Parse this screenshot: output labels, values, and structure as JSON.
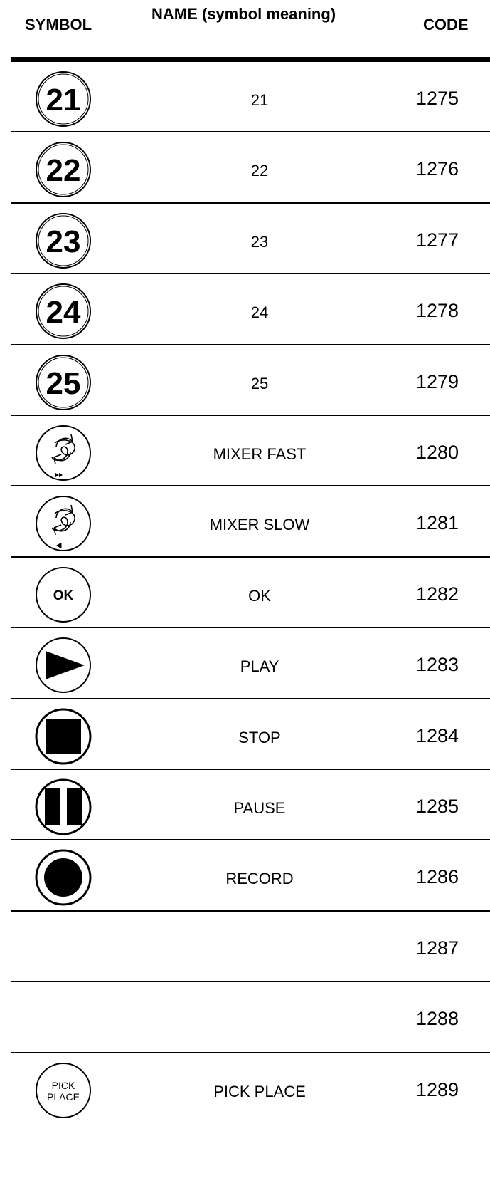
{
  "header": {
    "symbol": "SYMBOL",
    "name": "NAME (symbol meaning)",
    "code": "CODE"
  },
  "rows": [
    {
      "icon": "number-21-icon",
      "glyph": "21",
      "name": "21",
      "code": "1275"
    },
    {
      "icon": "number-22-icon",
      "glyph": "22",
      "name": "22",
      "code": "1276"
    },
    {
      "icon": "number-23-icon",
      "glyph": "23",
      "name": "23",
      "code": "1277"
    },
    {
      "icon": "number-24-icon",
      "glyph": "24",
      "name": "24",
      "code": "1278"
    },
    {
      "icon": "number-25-icon",
      "glyph": "25",
      "name": "25",
      "code": "1279"
    },
    {
      "icon": "mixer-fast-icon",
      "name": "MIXER FAST",
      "code": "1280"
    },
    {
      "icon": "mixer-slow-icon",
      "name": "MIXER SLOW",
      "code": "1281"
    },
    {
      "icon": "ok-icon",
      "glyph": "OK",
      "name": "OK",
      "code": "1282"
    },
    {
      "icon": "play-icon",
      "name": "PLAY",
      "code": "1283"
    },
    {
      "icon": "stop-icon",
      "name": "STOP",
      "code": "1284"
    },
    {
      "icon": "pause-icon",
      "name": "PAUSE",
      "code": "1285"
    },
    {
      "icon": "record-icon",
      "name": "RECORD",
      "code": "1286"
    },
    {
      "name": "",
      "code": "1287"
    },
    {
      "name": "",
      "code": "1288"
    },
    {
      "icon": "pick-place-icon",
      "glyph": "PICK",
      "glyph2": "PLACE",
      "name": "PICK PLACE",
      "code": "1289"
    }
  ]
}
